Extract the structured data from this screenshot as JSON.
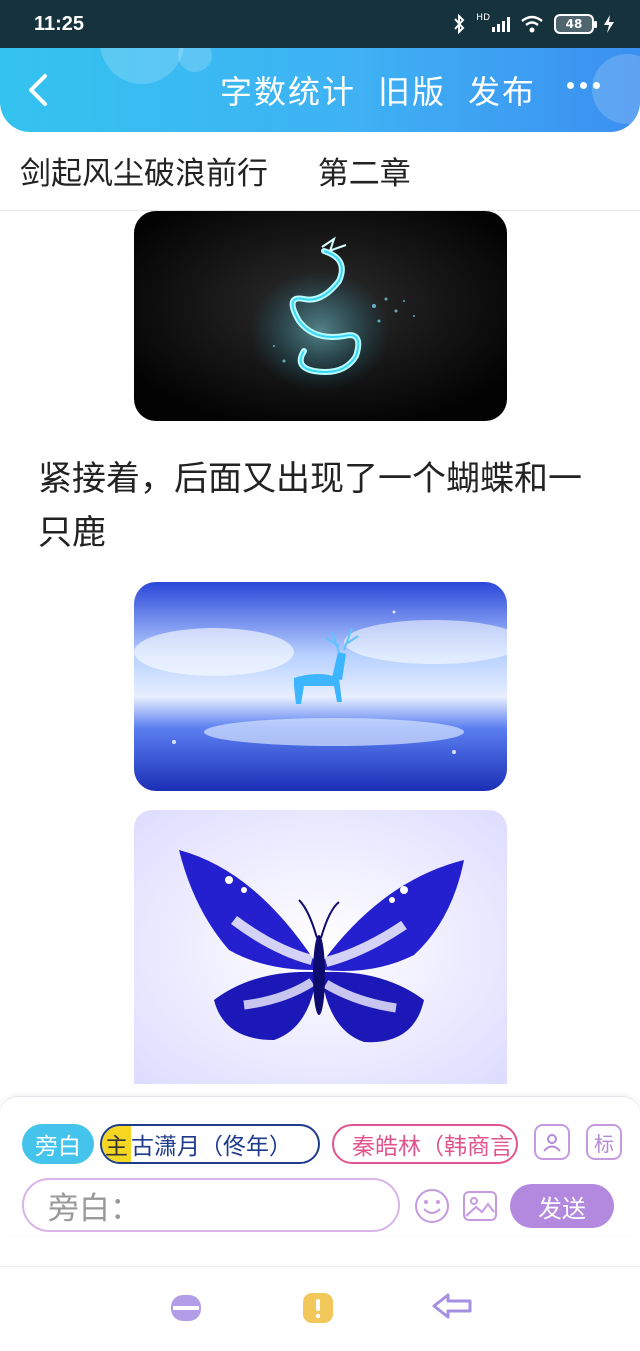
{
  "status_bar": {
    "time": "11:25",
    "network_label": "HD",
    "battery": "48"
  },
  "header": {
    "actions": [
      "字数统计",
      "旧版",
      "发布"
    ]
  },
  "chapter": {
    "book_title": "剑起风尘破浪前行",
    "chapter_name": "第二章"
  },
  "content": {
    "images": [
      {
        "icon": "dragon-image",
        "desc_colors": [
          "#050505",
          "#4fe6ff"
        ]
      },
      {
        "icon": "deer-image",
        "desc_colors": [
          "#2a3fd8",
          "#d9e6ff"
        ]
      },
      {
        "icon": "butterfly-image",
        "desc_colors": [
          "#1a1ad0",
          "#f2f0ff"
        ]
      }
    ],
    "narration": "紧接着，后面又出现了一个蝴蝶和一只鹿"
  },
  "input_panel": {
    "role_narrator": "旁白",
    "main_tag": "主",
    "role_main": "古潇月（佟年）",
    "role_other": "秦皓林（韩商言",
    "contact_icon": "contact-card-icon",
    "mark_label": "标",
    "input_placeholder": "旁白：",
    "send_label": "发送"
  },
  "colors": {
    "header_start": "#34c3ef",
    "header_end": "#3b8ff0",
    "send_button": "#b389e0",
    "main_role_border": "#1e3b8c",
    "other_role_border": "#e0558e"
  }
}
